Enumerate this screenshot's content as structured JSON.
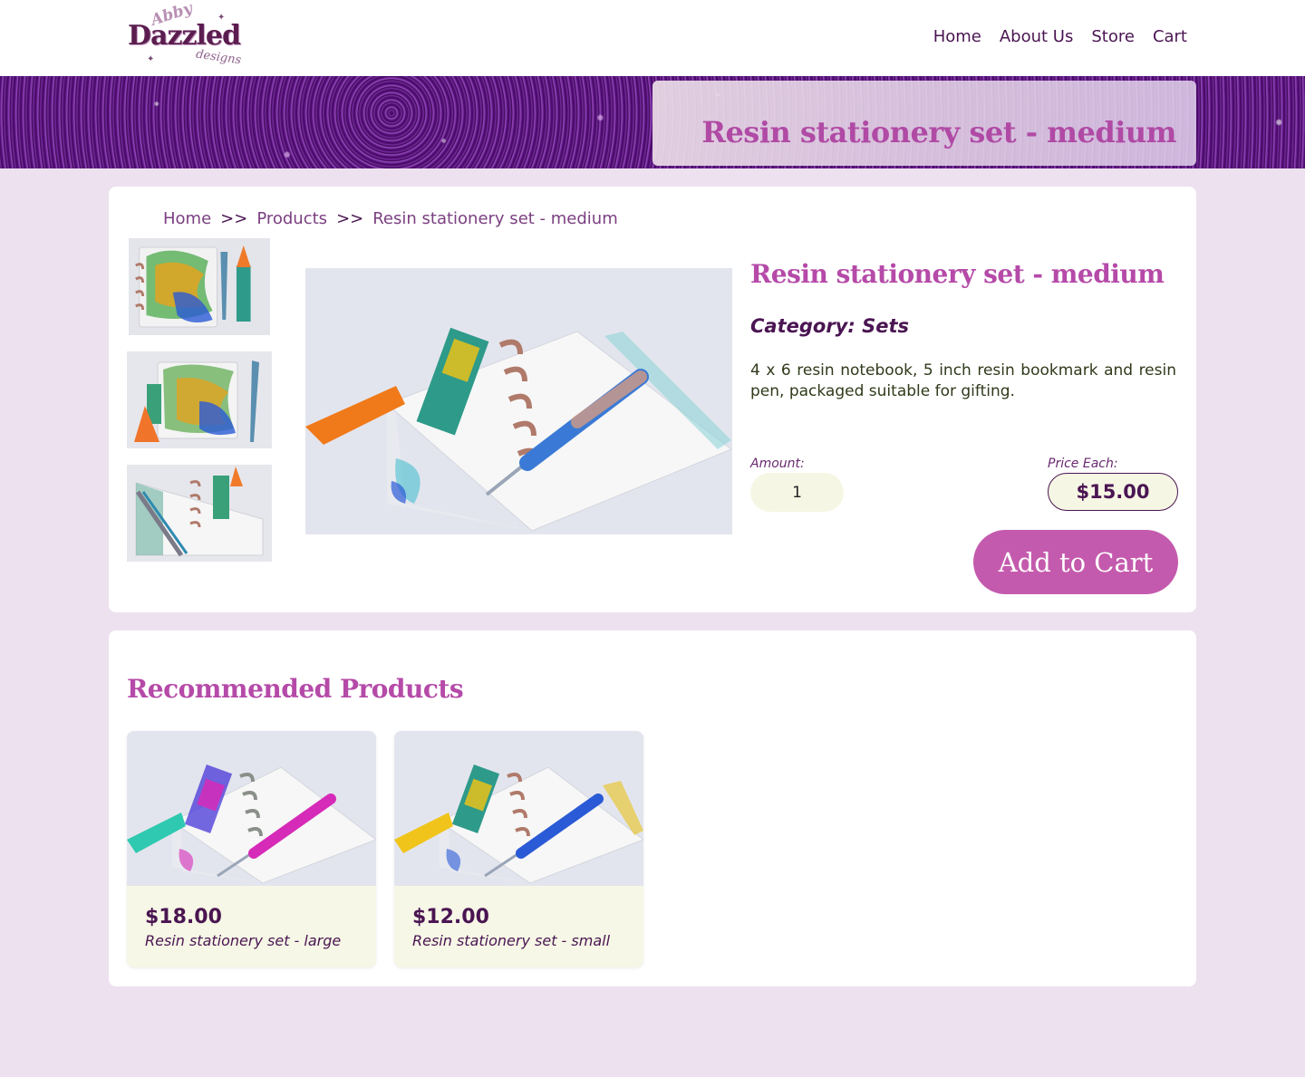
{
  "brand": {
    "logo_top": "Abby",
    "logo_main": "Dazzled",
    "logo_bottom": "designs"
  },
  "nav": {
    "home": "Home",
    "about": "About Us",
    "store": "Store",
    "cart": "Cart"
  },
  "banner": {
    "title": "Resin stationery set - medium"
  },
  "breadcrumb": {
    "home": "Home",
    "sep": ">>",
    "products": "Products",
    "current": "Resin stationery set - medium"
  },
  "product": {
    "title": "Resin stationery set - medium",
    "category": "Category: Sets",
    "description": "4 x 6 resin notebook, 5 inch resin bookmark and resin pen, packaged suitable for gifting.",
    "amount_label": "Amount:",
    "amount_value": "1",
    "price_label": "Price Each:",
    "price": "$15.00",
    "add_to_cart": "Add to Cart"
  },
  "recommended": {
    "title": "Recommended Products",
    "items": [
      {
        "price": "$18.00",
        "name": "Resin stationery set - large",
        "tassel_color": "#2ec9b0",
        "accent_color": "#d62ab8"
      },
      {
        "price": "$12.00",
        "name": "Resin stationery set - small",
        "tassel_color": "#f0c41a",
        "accent_color": "#2a5ad6"
      }
    ]
  },
  "colors": {
    "accent": "#c45aad",
    "heading": "#b54aa8",
    "text_dark": "#4a1552",
    "background": "#ede1ef",
    "field_bg": "#f6f6e4"
  }
}
